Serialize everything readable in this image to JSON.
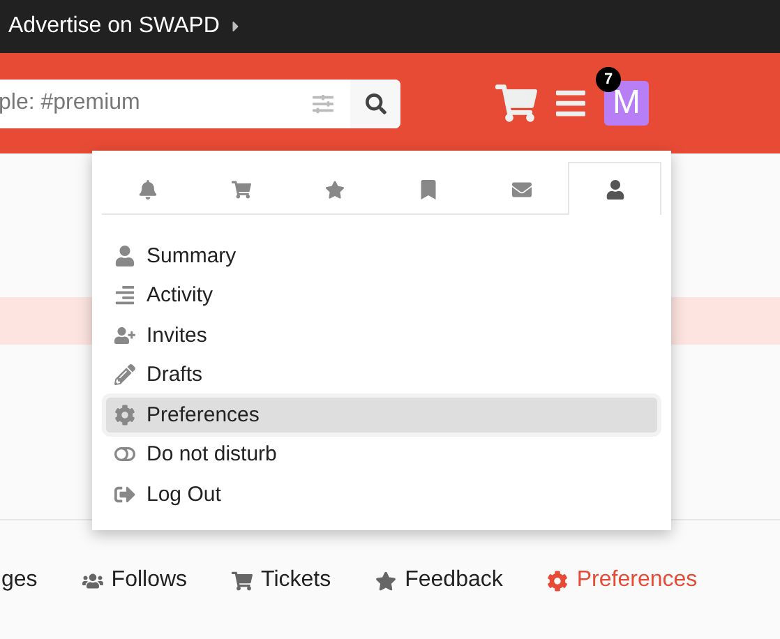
{
  "top_bar": {
    "link": "Advertise on SWAPD"
  },
  "header": {
    "search": {
      "placeholder": "ple: #premium"
    },
    "badge": "7",
    "avatar": "M"
  },
  "dropdown": {
    "tabs": [
      {
        "kind": "bell",
        "selected": false
      },
      {
        "kind": "cart",
        "selected": false
      },
      {
        "kind": "star",
        "selected": false
      },
      {
        "kind": "bookmark",
        "selected": false
      },
      {
        "kind": "envelope",
        "selected": false
      },
      {
        "kind": "user",
        "selected": true
      }
    ],
    "items": [
      {
        "label": "Summary",
        "kind": "user",
        "selected": false
      },
      {
        "label": "Activity",
        "kind": "lines",
        "selected": false
      },
      {
        "label": "Invites",
        "kind": "user-plus",
        "selected": false
      },
      {
        "label": "Drafts",
        "kind": "pencil",
        "selected": false
      },
      {
        "label": "Preferences",
        "kind": "gear",
        "selected": true
      },
      {
        "label": "Do not disturb",
        "kind": "toggle",
        "selected": false
      },
      {
        "label": "Log Out",
        "kind": "logout",
        "selected": false
      }
    ]
  },
  "bottom_nav": [
    {
      "label": "ges",
      "kind": "none",
      "selected": false
    },
    {
      "label": "Follows",
      "kind": "users",
      "selected": false
    },
    {
      "label": "Tickets",
      "kind": "cart",
      "selected": false
    },
    {
      "label": "Feedback",
      "kind": "star",
      "selected": false
    },
    {
      "label": "Preferences",
      "kind": "gear",
      "selected": true
    }
  ]
}
